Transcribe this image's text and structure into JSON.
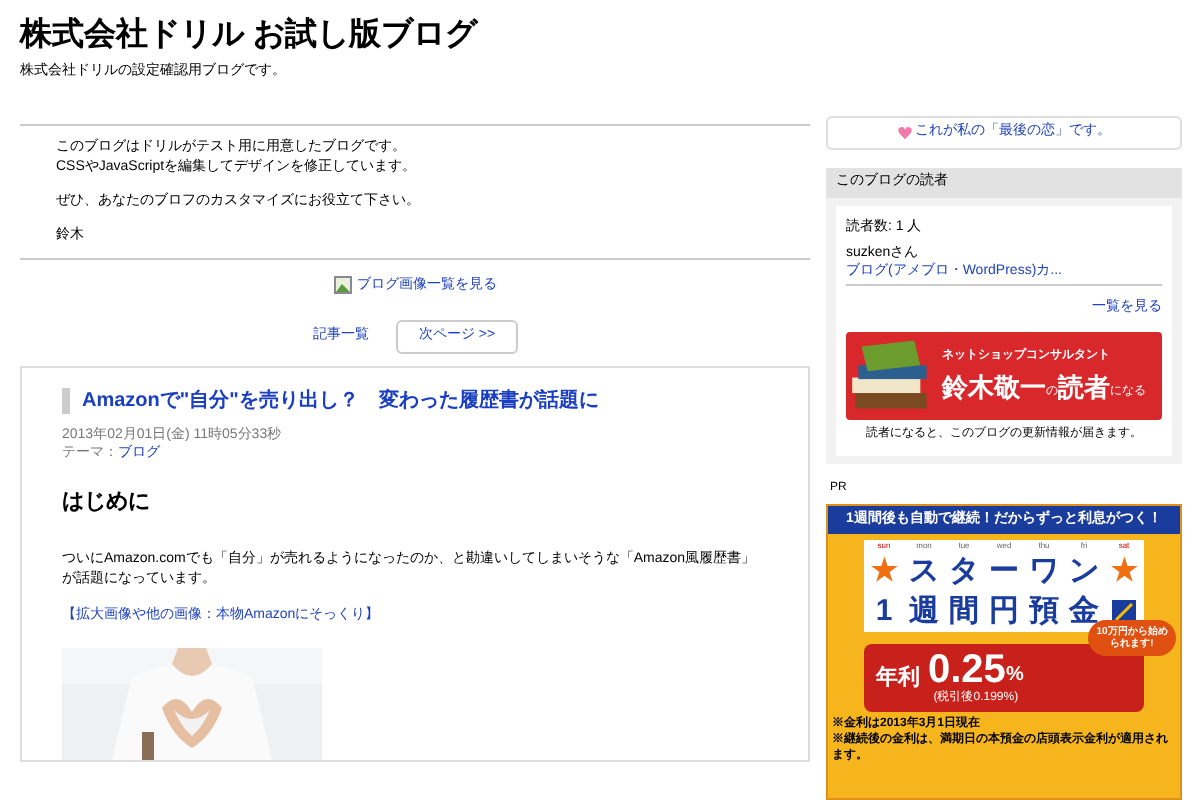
{
  "header": {
    "title": "株式会社ドリル お試し版ブログ",
    "subtitle": "株式会社ドリルの設定確認用ブログです。"
  },
  "intro": {
    "lines": [
      "このブログはドリルがテスト用に用意したブログです。",
      "CSSやJavaScriptを編集してデザインを修正しています。",
      "ぜひ、あなたのブロフのカスタマイズにお役立て下さい。",
      "鈴木"
    ]
  },
  "image_list_link": "ブログ画像一覧を見る",
  "pager": {
    "list_link": "記事一覧",
    "next_button": "次ページ >>"
  },
  "article": {
    "title": "Amazonで\"自分\"を売り出し？　変わった履歴書が話題に",
    "date": "2013年02月01日(金) 11時05分33秒",
    "theme_label": "テーマ：",
    "theme": "ブログ",
    "heading": "はじめに",
    "body": "ついにAmazon.comでも「自分」が売れるようになったのか、と勘違いしてしまいそうな「Amazon風履歴書」が話題になっています。",
    "image_link": "【拡大画像や他の画像：本物Amazonにそっくり】"
  },
  "sidebar": {
    "message": "これが私の「最後の恋」です。",
    "readers": {
      "title": "このブログの読者",
      "count": "読者数: 1 人",
      "reader_name": "suzkenさん",
      "reader_blog": "ブログ(アメブロ・WordPress)カ...",
      "more_link": "一覧を見る",
      "banner_caption": "ネットショップコンサルタント",
      "banner_name": "鈴木敬一",
      "banner_no": "の",
      "banner_reader": "読者",
      "banner_suffix": "になる",
      "note": "読者になると、このブログの更新情報が届きます。"
    },
    "pr_label": "PR",
    "ad": {
      "headline": "1週間後も自動で継続！だからずっと利息がつく！",
      "days": [
        "sun",
        "mon",
        "tue",
        "wed",
        "thu",
        "fri",
        "sat"
      ],
      "row1": [
        "★",
        "ス",
        "タ",
        "ー",
        "ワ",
        "ン",
        "★"
      ],
      "row2": [
        "1",
        "週",
        "間",
        "円",
        "預",
        "金"
      ],
      "rate_label": "年利",
      "rate": "0.25",
      "percent": "%",
      "after_tax": "(税引後0.199%)",
      "bubble": "10万円から始められます!",
      "notes": [
        "※金利は2013年3月1日現在",
        "※継続後の金利は、満期日の本預金の店頭表示金利が適用されます。"
      ]
    }
  }
}
